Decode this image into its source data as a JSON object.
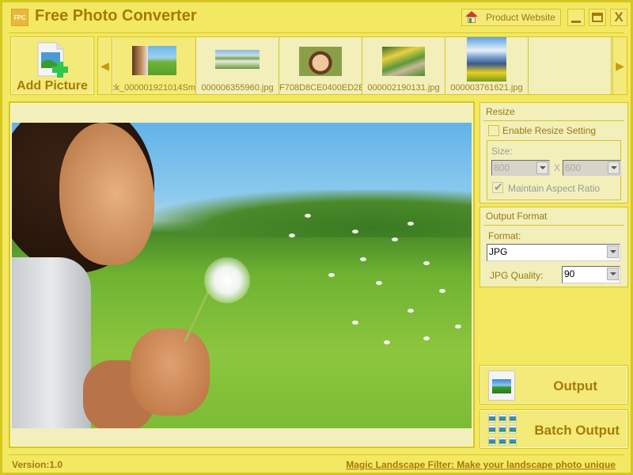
{
  "app": {
    "title": "Free Photo Converter",
    "logo_text": "FPC",
    "product_website_label": "Product Website",
    "close_label": "X"
  },
  "toolbar": {
    "add_picture_label": "Add Picture",
    "prev_arrow": "◀",
    "next_arrow": "▶"
  },
  "thumbnails": [
    {
      "filename": "ck_000001921014Sm",
      "selected": true
    },
    {
      "filename": "000006355960.jpg",
      "selected": false
    },
    {
      "filename": "F708D8CE0400ED2E",
      "selected": false
    },
    {
      "filename": "000002190131.jpg",
      "selected": false
    },
    {
      "filename": "000003761621.jpg",
      "selected": false
    }
  ],
  "resize": {
    "title": "Resize",
    "enable_label": "Enable Resize Setting",
    "enable_checked": false,
    "size_label": "Size:",
    "width_value": "800",
    "separator": "X",
    "height_value": "600",
    "aspect_label": "Maintain Aspect Ratio",
    "aspect_checked": true
  },
  "output_format": {
    "title": "Output Format",
    "format_label": "Format:",
    "format_value": "JPG",
    "quality_label": "JPG Quality:",
    "quality_value": "90"
  },
  "actions": {
    "output_label": "Output",
    "batch_output_label": "Batch Output"
  },
  "status": {
    "version": "Version:1.0",
    "promo_link": "Magic Landscape Filter: Make your landscape photo unique"
  },
  "colors": {
    "background": "#f3e862",
    "border": "#d6c622",
    "accent_text": "#a67a05",
    "panel": "#f2efbb"
  }
}
